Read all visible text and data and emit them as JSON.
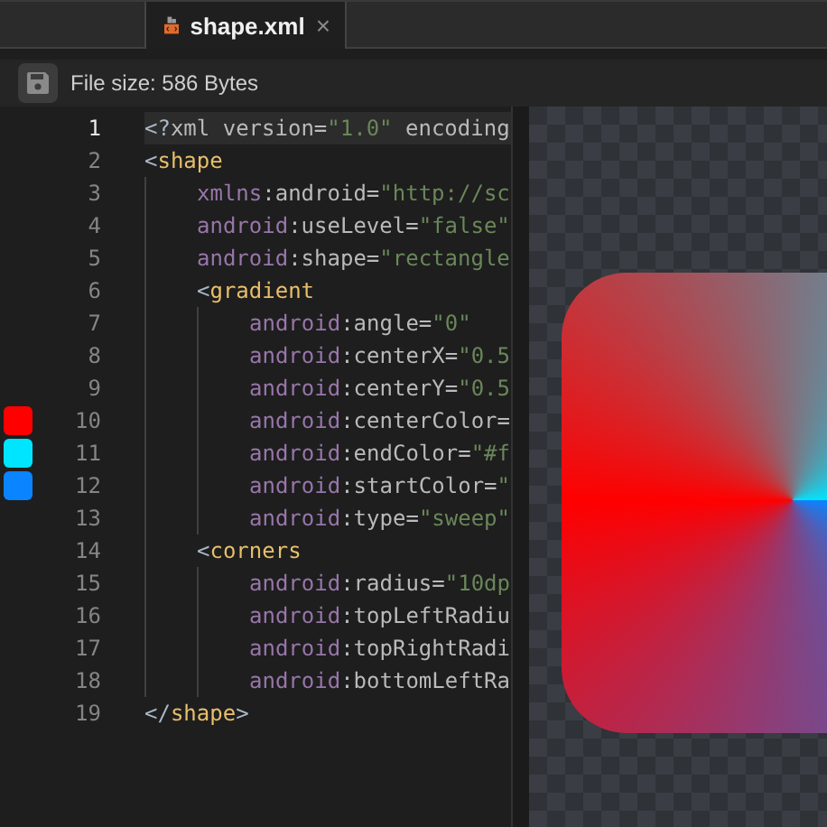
{
  "tab": {
    "label": "shape.xml",
    "close": "×"
  },
  "toolbar": {
    "file_size": "File size: 586 Bytes"
  },
  "editor": {
    "lines": [
      {
        "number": "1",
        "active": true,
        "tokens": [
          {
            "kind": "punct",
            "text": "<?"
          },
          {
            "kind": "name",
            "text": "xml version="
          },
          {
            "kind": "string",
            "text": "\"1.0\""
          },
          {
            "kind": "name",
            "text": " encoding"
          }
        ]
      },
      {
        "number": "2",
        "active": false,
        "tokens": [
          {
            "kind": "punct",
            "text": "<"
          },
          {
            "kind": "tag",
            "text": "shape"
          }
        ],
        "children": [
          {
            "number": "3",
            "active": false,
            "tokens": [
              {
                "kind": "ns",
                "text": "xmlns"
              },
              {
                "kind": "name",
                "text": ":android="
              },
              {
                "kind": "string",
                "text": "\"http://sc"
              }
            ]
          },
          {
            "number": "4",
            "active": false,
            "tokens": [
              {
                "kind": "ns",
                "text": "android"
              },
              {
                "kind": "name",
                "text": ":useLevel="
              },
              {
                "kind": "string",
                "text": "\"false\""
              }
            ]
          },
          {
            "number": "5",
            "active": false,
            "tokens": [
              {
                "kind": "ns",
                "text": "android"
              },
              {
                "kind": "name",
                "text": ":shape="
              },
              {
                "kind": "string",
                "text": "\"rectangle"
              }
            ]
          },
          {
            "number": "6",
            "active": false,
            "tokens": [
              {
                "kind": "punct",
                "text": "<"
              },
              {
                "kind": "tag",
                "text": "gradient"
              }
            ],
            "children": [
              {
                "number": "7",
                "active": false,
                "tokens": [
                  {
                    "kind": "ns",
                    "text": "android"
                  },
                  {
                    "kind": "name",
                    "text": ":angle="
                  },
                  {
                    "kind": "string",
                    "text": "\"0\""
                  }
                ]
              },
              {
                "number": "8",
                "active": false,
                "tokens": [
                  {
                    "kind": "ns",
                    "text": "android"
                  },
                  {
                    "kind": "name",
                    "text": ":centerX="
                  },
                  {
                    "kind": "string",
                    "text": "\"0.5"
                  }
                ]
              },
              {
                "number": "9",
                "active": false,
                "tokens": [
                  {
                    "kind": "ns",
                    "text": "android"
                  },
                  {
                    "kind": "name",
                    "text": ":centerY="
                  },
                  {
                    "kind": "string",
                    "text": "\"0.5"
                  }
                ]
              },
              {
                "number": "10",
                "active": false,
                "color": "#ff0000",
                "tokens": [
                  {
                    "kind": "ns",
                    "text": "android"
                  },
                  {
                    "kind": "name",
                    "text": ":centerColor="
                  }
                ]
              },
              {
                "number": "11",
                "active": false,
                "color": "#00e5ff",
                "tokens": [
                  {
                    "kind": "ns",
                    "text": "android"
                  },
                  {
                    "kind": "name",
                    "text": ":endColor="
                  },
                  {
                    "kind": "string",
                    "text": "\"#f"
                  }
                ]
              },
              {
                "number": "12",
                "active": false,
                "color": "#0a84ff",
                "tokens": [
                  {
                    "kind": "ns",
                    "text": "android"
                  },
                  {
                    "kind": "name",
                    "text": ":startColor="
                  },
                  {
                    "kind": "string",
                    "text": "\""
                  }
                ]
              },
              {
                "number": "13",
                "active": false,
                "tokens": [
                  {
                    "kind": "ns",
                    "text": "android"
                  },
                  {
                    "kind": "name",
                    "text": ":type="
                  },
                  {
                    "kind": "string",
                    "text": "\"sweep\""
                  }
                ]
              }
            ]
          },
          {
            "number": "14",
            "active": false,
            "tokens": [
              {
                "kind": "punct",
                "text": "<"
              },
              {
                "kind": "tag",
                "text": "corners"
              }
            ],
            "children": [
              {
                "number": "15",
                "active": false,
                "tokens": [
                  {
                    "kind": "ns",
                    "text": "android"
                  },
                  {
                    "kind": "name",
                    "text": ":radius="
                  },
                  {
                    "kind": "string",
                    "text": "\"10dp"
                  }
                ]
              },
              {
                "number": "16",
                "active": false,
                "tokens": [
                  {
                    "kind": "ns",
                    "text": "android"
                  },
                  {
                    "kind": "name",
                    "text": ":topLeftRadiu"
                  }
                ]
              },
              {
                "number": "17",
                "active": false,
                "tokens": [
                  {
                    "kind": "ns",
                    "text": "android"
                  },
                  {
                    "kind": "name",
                    "text": ":topRightRadi"
                  }
                ]
              },
              {
                "number": "18",
                "active": false,
                "tokens": [
                  {
                    "kind": "ns",
                    "text": "android"
                  },
                  {
                    "kind": "name",
                    "text": ":bottomLeftRa"
                  }
                ]
              }
            ]
          }
        ]
      },
      {
        "number": "19",
        "active": false,
        "tokens": [
          {
            "kind": "punct",
            "text": "</"
          },
          {
            "kind": "tag",
            "text": "shape"
          },
          {
            "kind": "punct",
            "text": ">"
          }
        ]
      }
    ]
  }
}
